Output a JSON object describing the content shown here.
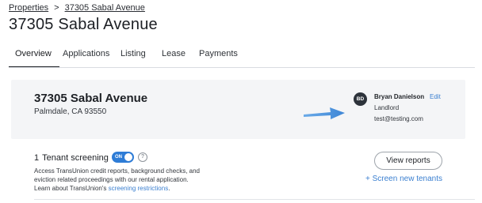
{
  "breadcrumb": {
    "parent": "Properties",
    "separator": ">",
    "current": "37305 Sabal Avenue"
  },
  "page_title": "37305 Sabal Avenue",
  "tabs": [
    {
      "label": "Overview",
      "active": true
    },
    {
      "label": "Applications"
    },
    {
      "label": "Listing"
    },
    {
      "label": "Lease"
    },
    {
      "label": "Payments"
    }
  ],
  "property": {
    "name": "37305 Sabal Avenue",
    "address": "Palmdale, CA 93550"
  },
  "owner": {
    "initials": "BD",
    "name": "Bryan Danielson",
    "edit_label": "Edit",
    "role": "Landlord",
    "email": "test@testing.com"
  },
  "annotation": {
    "icon": "arrow-right-icon",
    "color": "#4a90d9"
  },
  "tenant_screening": {
    "count": "1",
    "title": "Tenant screening",
    "toggle_label": "ON",
    "toggle_state": true,
    "help_glyph": "?",
    "desc_line1": "Access TransUnion credit reports, background checks, and",
    "desc_line2": "eviction related proceedings with our rental application.",
    "desc_line3_prefix": "Learn about TransUnion's",
    "desc_link": "screening restrictions",
    "desc_suffix": ".",
    "view_button": "View reports",
    "new_link": "+ Screen new tenants"
  },
  "colors": {
    "accent": "#2e7cd6",
    "link": "#3a7fd0",
    "card_bg": "#f4f5f7"
  }
}
